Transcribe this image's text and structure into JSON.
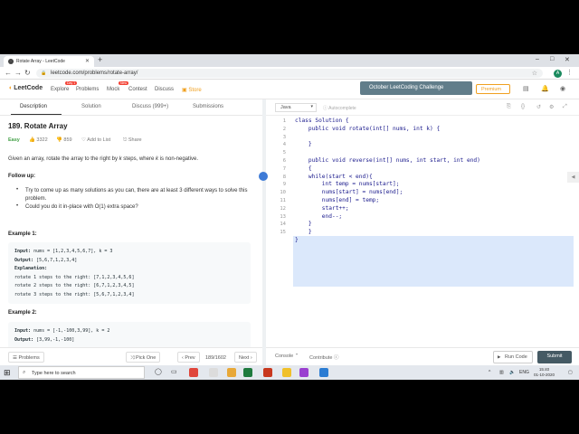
{
  "browser": {
    "tab_title": "Rotate Array - LeetCode",
    "url": "leetcode.com/problems/rotate-array/",
    "profile_initial": "A"
  },
  "leetcode_nav": {
    "logo": "LeetCode",
    "items": [
      "Explore",
      "Problems",
      "Mock",
      "Contest",
      "Discuss",
      "Store"
    ],
    "explore_badge": "Day 1",
    "mock_badge": "New",
    "challenge": "October LeetCoding Challenge",
    "premium": "Premium"
  },
  "problem": {
    "tabs": [
      "Description",
      "Solution",
      "Discuss (999+)",
      "Submissions"
    ],
    "title": "189. Rotate Array",
    "difficulty": "Easy",
    "likes": "3322",
    "dislikes": "859",
    "add_to_list": "Add to List",
    "share": "Share",
    "description_1": "Given an array, rotate the array to the right by ",
    "description_k": "k",
    "description_2": " steps, where ",
    "description_3": " is non-negative.",
    "follow_up_heading": "Follow up:",
    "follow_up": [
      "Try to come up as many solutions as you can, there are at least 3 different ways to solve this problem.",
      "Could you do it in-place with O(1) extra space?"
    ],
    "example1_heading": "Example 1:",
    "example1": {
      "input_label": "Input:",
      "input": " nums = [1,2,3,4,5,6,7], k = 3",
      "output_label": "Output:",
      "output": " [5,6,7,1,2,3,4]",
      "explanation_label": "Explanation:",
      "lines": [
        "rotate 1 steps to the right: [7,1,2,3,4,5,6]",
        "rotate 2 steps to the right: [6,7,1,2,3,4,5]",
        "rotate 3 steps to the right: [5,6,7,1,2,3,4]"
      ]
    },
    "example2_heading": "Example 2:",
    "example2": {
      "input_label": "Input:",
      "input": " nums = [-1,-100,3,99], k = 2",
      "output_label": "Output:",
      "output": " [3,99,-1,-100]"
    }
  },
  "left_footer": {
    "problems": "Problems",
    "pick_one": "Pick One",
    "prev": "Prev",
    "pager": "189/1602",
    "next": "Next"
  },
  "editor": {
    "language": "Java",
    "autocomplete": "Autocomplete",
    "line_numbers": [
      "1",
      "2",
      "3",
      "4",
      "5",
      "6",
      "7",
      "8",
      "9",
      "10",
      "11",
      "12",
      "13",
      "14",
      "15"
    ],
    "lines": [
      "class Solution {",
      "    public void rotate(int[] nums, int k) {",
      "",
      "    }",
      "",
      "    public void reverse(int[] nums, int start, int end)",
      "    {",
      "    while(start < end){",
      "        int temp = nums[start];",
      "        nums[start] = nums[end];",
      "        nums[end] = temp;",
      "        start++;",
      "        end--;",
      "    }",
      "    }",
      "}"
    ],
    "console": "Console",
    "contribute": "Contribute",
    "run_code": "Run Code",
    "submit": "Submit"
  },
  "taskbar": {
    "search_placeholder": "Type here to search",
    "lang": "ENG",
    "time": "15:40",
    "date": "01-10-2020"
  }
}
